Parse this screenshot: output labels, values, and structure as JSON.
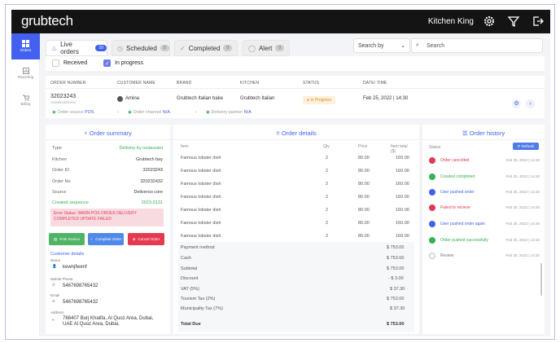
{
  "app": {
    "logo": "grubtech",
    "brand": "Kitchen King"
  },
  "sidebar": {
    "items": [
      {
        "label": "Orders"
      },
      {
        "label": "Reporting"
      },
      {
        "label": "Billing"
      }
    ]
  },
  "tabs": [
    {
      "label": "Live orders",
      "count": "10"
    },
    {
      "label": "Scheduled",
      "count": "0"
    },
    {
      "label": "Completed",
      "count": "0"
    },
    {
      "label": "Alert",
      "count": "0"
    }
  ],
  "search": {
    "select": "Search by",
    "placeholder": "Search"
  },
  "filters": {
    "received": "Received",
    "in_progress": "In progress"
  },
  "order": {
    "headers": [
      "ORDER NUMBER",
      "CUSTOMER NAME",
      "BRAND",
      "KITCHEN",
      "STATUS",
      "DATE/ TIME"
    ],
    "number": "32023243",
    "number_sub": "1000981932001910",
    "customer": "Amina",
    "brand": "Grubtech Italian bake",
    "kitchen": "Grubtech Italian",
    "status": "In Progress",
    "datetime": "Feb 25, 2022 | 14:30",
    "source_label": "Order source",
    "source": "POS",
    "channel_label": "Order channel",
    "channel": "N/A",
    "partner_label": "Delivery partner",
    "partner": "N/A"
  },
  "summary": {
    "title": "Order summary",
    "rows": [
      {
        "k": "Type",
        "v": "Delivery by restaurant"
      },
      {
        "k": "Kitchen",
        "v": "Grubtech bay"
      },
      {
        "k": "Order ID",
        "v": "32023243"
      },
      {
        "k": "Order No",
        "v": "320232432"
      },
      {
        "k": "Source",
        "v": "Deliveroo core"
      },
      {
        "k": "Created sequence",
        "v": "2023-0131"
      }
    ],
    "error": "Error Status: WARN POS ORDER DELIVERY COMPLETED UPDATE FAILED",
    "buttons": [
      "Print Invoice",
      "Complete Order",
      "Cancel Order"
    ],
    "customer_title": "Customer details",
    "name_label": "Name",
    "name": "kewnjfwenf",
    "phone_label": "Mobile Phone",
    "phone": "5467698765432",
    "email_label": "Email",
    "email": "5467698765432",
    "address_label": "Address",
    "address": "768407 Burj Khalifa, Al Quoz Area, Dubai, UAE  Al Quoz Area, Dubai,"
  },
  "details": {
    "title": "Order details",
    "headers": [
      "Item",
      "Qty",
      "Price",
      "Item total ($)"
    ],
    "items": [
      {
        "name": "Famous lobster dish",
        "qty": "2",
        "price": "80.00",
        "total": "160.00"
      },
      {
        "name": "Famous lobster dish",
        "qty": "2",
        "price": "80.00",
        "total": "160.00"
      },
      {
        "name": "Famous lobster dish",
        "qty": "2",
        "price": "80.00",
        "total": "160.00"
      },
      {
        "name": "Famous lobster dish",
        "qty": "2",
        "price": "80.00",
        "total": "160.00"
      },
      {
        "name": "Famous lobster dish",
        "qty": "2",
        "price": "80.00",
        "total": "160.00"
      },
      {
        "name": "Famous lobster dish",
        "qty": "2",
        "price": "80.00",
        "total": "160.00"
      },
      {
        "name": "Famous lobster dish",
        "qty": "2",
        "price": "80.00",
        "total": "160.00"
      }
    ],
    "totals": [
      {
        "k": "Payment method",
        "v": "$ 753.00"
      },
      {
        "k": "Cash",
        "v": "$ 753.00"
      },
      {
        "k": "Subtotal",
        "v": "$ 753.00"
      },
      {
        "k": "Discount",
        "v": "- $ 3.00"
      },
      {
        "k": "VAT (5%)",
        "v": "$ 37.30"
      },
      {
        "k": "Tourism Tax (2%)",
        "v": "$ 753.00"
      },
      {
        "k": "Municipality Tax (7%)",
        "v": "$ 37.30"
      }
    ],
    "total_label": "Total Due",
    "total": "$ 753.00"
  },
  "history": {
    "title": "Order history",
    "status_label": "Status",
    "refresh": "Refresh",
    "rows": [
      {
        "label": "Order cancelled",
        "color": "#e53950",
        "date": "Feb 25, 2022 | 14:30"
      },
      {
        "label": "Created completed",
        "color": "#35b056",
        "date": "Feb 25, 2022 | 14:30"
      },
      {
        "label": "User pushed order",
        "color": "#4361ee",
        "date": "Feb 25, 2022 | 14:30"
      },
      {
        "label": "Failed to recieve",
        "color": "#e53950",
        "date": "Feb 25, 2022 | 14:30"
      },
      {
        "label": "User pushed order again",
        "color": "#4361ee",
        "date": "Feb 25, 2022 | 14:30"
      },
      {
        "label": "Order pushed successfully",
        "color": "#35b056",
        "date": "Feb 25, 2022 | 14:30"
      },
      {
        "label": "Review",
        "color": "#ffffff",
        "date": "Feb 25, 2022 | 14:30"
      }
    ]
  }
}
